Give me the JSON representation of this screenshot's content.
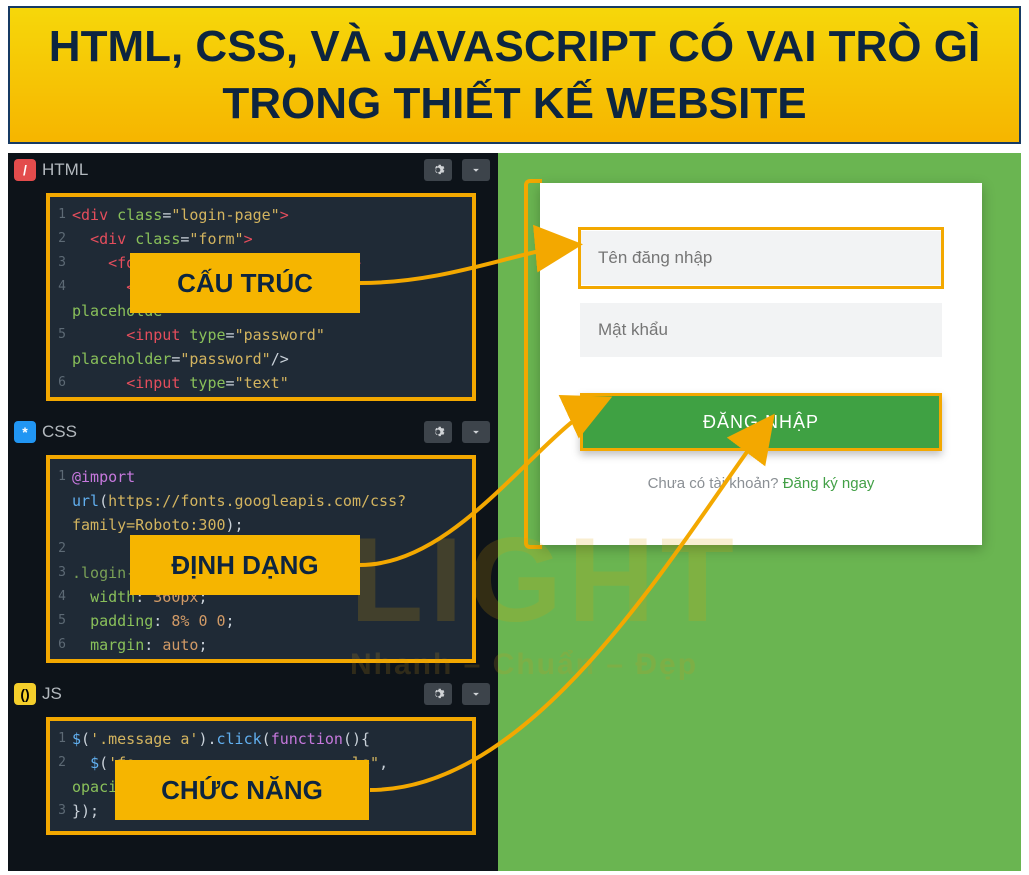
{
  "title": "HTML, CSS, VÀ JAVASCRIPT CÓ VAI TRÒ GÌ TRONG THIẾT KẾ WEBSITE",
  "panels": {
    "html": {
      "indicator": "/",
      "label": "HTML"
    },
    "css": {
      "indicator": "*",
      "label": "CSS"
    },
    "js": {
      "indicator": "()",
      "label": "JS"
    }
  },
  "labels": {
    "html": "CẤU TRÚC",
    "css": "ĐỊNH DẠNG",
    "js": "CHỨC NĂNG"
  },
  "code": {
    "html": {
      "lines": [
        {
          "n": "1",
          "html": "<span class='c-tag'>&lt;div</span> <span class='c-attr'>class</span>=<span class='c-str'>\"login-page\"</span><span class='c-tag'>&gt;</span>"
        },
        {
          "n": "2",
          "html": "  <span class='c-tag'>&lt;div</span> <span class='c-attr'>class</span>=<span class='c-str'>\"form\"</span><span class='c-tag'>&gt;</span>"
        },
        {
          "n": "3",
          "html": "    <span class='c-tag'>&lt;form</span> <span class='c-attr'>class</span>=<span class='c-str'>\"register-form\"</span><span class='c-tag'>&gt;</span>"
        },
        {
          "n": "4",
          "html": "      <span class='c-tag'>&lt;inp</span>"
        },
        {
          "n": "",
          "html": "<span class='c-attr'>placeholde</span>"
        },
        {
          "n": "5",
          "html": "      <span class='c-tag'>&lt;input</span> <span class='c-attr'>type</span>=<span class='c-str'>\"password\"</span>"
        },
        {
          "n": "",
          "html": "<span class='c-attr'>placeholder</span>=<span class='c-str'>\"password\"</span>/&gt;"
        },
        {
          "n": "6",
          "html": "      <span class='c-tag'>&lt;input</span> <span class='c-attr'>type</span>=<span class='c-str'>\"text\"</span>"
        }
      ]
    },
    "css": {
      "lines": [
        {
          "n": "1",
          "html": "<span class='c-keyword'>@import</span>"
        },
        {
          "n": "",
          "html": "<span class='c-fn'>url</span>(<span class='c-str'>https://fonts.googleapis.com/css?</span>"
        },
        {
          "n": "",
          "html": "<span class='c-str'>family=Roboto:300</span>);"
        },
        {
          "n": "2",
          "html": ""
        },
        {
          "n": "3",
          "html": "<span class='c-id'>.login-pa</span>"
        },
        {
          "n": "4",
          "html": "  <span class='c-attr'>width</span>: <span class='c-num'>360px</span>;"
        },
        {
          "n": "5",
          "html": "  <span class='c-attr'>padding</span>: <span class='c-num'>8%</span> <span class='c-num'>0</span> <span class='c-num'>0</span>;"
        },
        {
          "n": "6",
          "html": "  <span class='c-attr'>margin</span>: <span class='c-num'>auto</span>;"
        }
      ]
    },
    "js": {
      "lines": [
        {
          "n": "1",
          "html": "<span class='c-fn'>$</span>(<span class='c-str'>'.message a'</span>).<span class='c-fn'>click</span>(<span class='c-keyword'>function</span>(){"
        },
        {
          "n": "2",
          "html": "  <span class='c-fn'>$</span>(<span class='c-str'>'fo</span>                        <span class='c-str'>le\"</span>,"
        },
        {
          "n": "",
          "html": "<span class='c-attr'>opacity</span>"
        },
        {
          "n": "3",
          "html": "});"
        }
      ]
    }
  },
  "preview": {
    "username_placeholder": "Tên đăng nhập",
    "password_placeholder": "Mật khẩu",
    "login_button": "ĐĂNG NHẬP",
    "signup_prompt": "Chưa có tài khoản? ",
    "signup_link": "Đăng ký ngay"
  },
  "watermark": {
    "big": "LIGHT",
    "sub": "Nhanh – Chuẩn – Đẹp"
  }
}
